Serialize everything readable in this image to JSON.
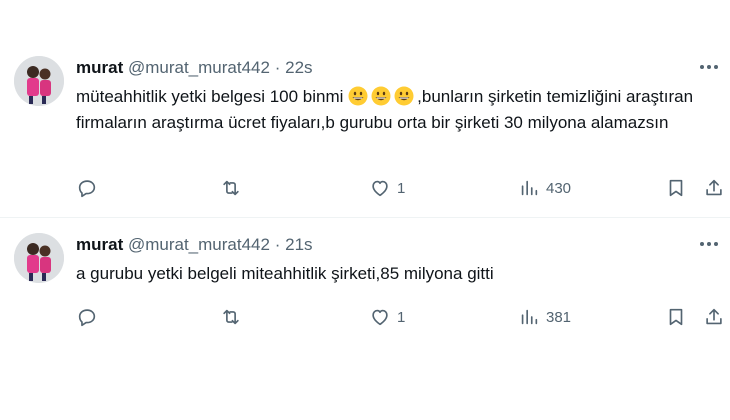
{
  "tweets": [
    {
      "name": "murat",
      "handle": "@murat_murat442",
      "dot": "·",
      "time": "22s",
      "text_before": "müteahhitlik yetki belgesi 100 binmi",
      "emojis": [
        "grinning-face",
        "grinning-face",
        "grinning-face"
      ],
      "text_after": ",bunların şirketin temizliğini araştıran firmaların araştırma ücret fiyaları,b gurubu orta bir şirketi 30 milyona alamazsın",
      "likes": "1",
      "views": "430"
    },
    {
      "name": "murat",
      "handle": "@murat_murat442",
      "dot": "·",
      "time": "21s",
      "text_before": "a gurubu yetki belgeli miteahhitlik şirketi,85 milyona gitti",
      "likes": "1",
      "views": "381"
    }
  ],
  "icons": {
    "reply": "reply-icon",
    "retweet": "retweet-icon",
    "like": "heart-icon",
    "views": "views-icon",
    "bookmark": "bookmark-icon",
    "share": "share-icon",
    "more": "more-icon"
  },
  "colors": {
    "text": "#0f1419",
    "secondary": "#536471",
    "divider": "#eff3f4",
    "emoji": "#ffcc33"
  }
}
